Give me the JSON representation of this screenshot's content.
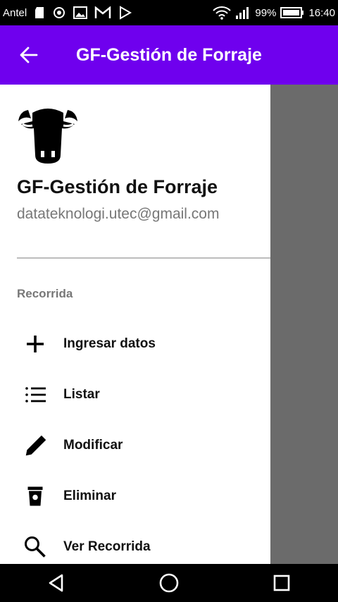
{
  "status_bar": {
    "carrier": "Antel",
    "battery": "99%",
    "time": "16:40"
  },
  "app_bar": {
    "title": "GF-Gestión de Forraje"
  },
  "drawer": {
    "header_title": "GF-Gestión de Forraje",
    "email": "datateknologi.utec@gmail.com",
    "section_label": "Recorrida",
    "items": [
      {
        "label": "Ingresar datos",
        "icon": "plus-icon"
      },
      {
        "label": "Listar",
        "icon": "list-icon"
      },
      {
        "label": "Modificar",
        "icon": "pencil-icon"
      },
      {
        "label": "Eliminar",
        "icon": "trash-icon"
      },
      {
        "label": "Ver Recorrida",
        "icon": "search-icon"
      }
    ]
  },
  "colors": {
    "app_bar": "#6f00ee",
    "scrim": "#6b6b6b"
  }
}
